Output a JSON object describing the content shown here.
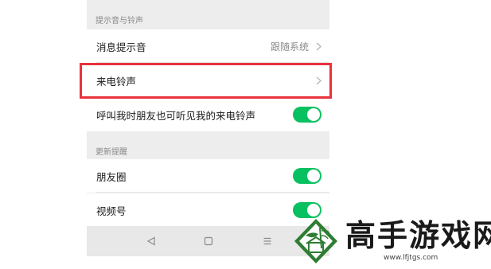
{
  "sections": [
    {
      "header": "提示音与铃声",
      "rows": [
        {
          "label": "消息提示音",
          "value": "跟随系统",
          "control": "chevron"
        },
        {
          "label": "来电铃声",
          "value": "",
          "control": "chevron"
        },
        {
          "label": "呼叫我时朋友也可听见我的来电铃声",
          "control": "toggle",
          "on": true
        }
      ]
    },
    {
      "header": "更新提醒",
      "rows": [
        {
          "label": "朋友圈",
          "control": "toggle",
          "on": true
        },
        {
          "label": "视频号",
          "control": "toggle",
          "on": true
        }
      ]
    }
  ],
  "navbar": {
    "icons": [
      "back-triangle-icon",
      "home-square-icon",
      "menu-lines-icon"
    ]
  },
  "colors": {
    "toggle_on": "#07c160",
    "highlight": "#e8323c",
    "background": "#ededed"
  },
  "watermark": {
    "title": "高手游戏网",
    "url": "www.lfjtgs.com"
  }
}
